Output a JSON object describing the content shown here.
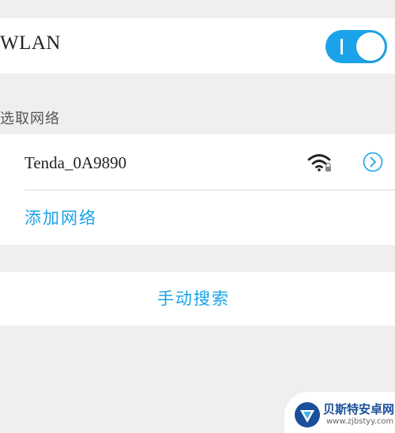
{
  "wlan": {
    "label": "WLAN",
    "enabled": true
  },
  "network_list": {
    "header": "选取网络",
    "networks": [
      {
        "name": "Tenda_0A9890",
        "signal_icon": "wifi-locked-icon",
        "info_icon": "chevron-right-circle-icon"
      }
    ],
    "add_network_label": "添加网络"
  },
  "manual_search": {
    "label": "手动搜索"
  },
  "watermark": {
    "title": "贝斯特安卓网",
    "url": "www.zjbstyy.com"
  },
  "colors": {
    "accent": "#1aa3e8",
    "background": "#efefef",
    "row_background": "#ffffff",
    "text": "#222222",
    "watermark_blue": "#1b4f99"
  }
}
